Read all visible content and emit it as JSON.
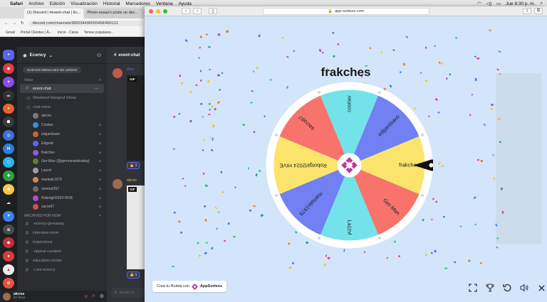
{
  "menubar": {
    "app": "Safari",
    "items": [
      "Archivo",
      "Edición",
      "Visualización",
      "Historial",
      "Marcadores",
      "Ventana",
      "Ayuda"
    ],
    "clock": "Jue 8:30 p. m."
  },
  "back_browser": {
    "tabs": [
      "(1) Discord | #event-chat | Ec...",
      "Photo-essay's posts on dec..."
    ],
    "url": "discord.com/channels/385034496555458/466121",
    "bookmarks": [
      "Gmail",
      "Portal Clientes | A...",
      "Inicio - Caixa",
      "Temas populares..."
    ]
  },
  "discord": {
    "server_name": "Ecency",
    "new_messages": "NUEVOS MENSAJES NO LEÍDOS",
    "voice_category": "Voice",
    "channels_top": [
      {
        "name": "event-chat",
        "active": true
      },
      {
        "name": "Weekend Hangout Show",
        "active": false
      },
      {
        "name": "chat-voice",
        "active": false
      }
    ],
    "voice_users": [
      "akrros",
      "Cositav",
      "edgardsaxo",
      "Edgerik",
      "frakches",
      "Ger-Man (@germanandradeg)",
      "Lazzvl",
      "martiale1979",
      "osomar357",
      "Robotgirl2024 HIVE",
      "sacra97"
    ],
    "archived_category": "ARCHIVED FOR NOW",
    "archived_channels": [
      "-ecency-giveaway",
      "interview-room",
      "inspections",
      "-appeal-curators",
      "education-center",
      "-i-am-ecency"
    ],
    "user": {
      "name": "akrros",
      "status": "En línea"
    },
    "chat_channel": "event-chat",
    "chat_user_1": "Mick",
    "chat_user_2": "akrros",
    "gif_label": "GIF",
    "reaction_1": "1",
    "reaction_2": "1",
    "input_placeholder": "Enviar m"
  },
  "front_browser": {
    "url": "app-sorteos.com"
  },
  "wheel": {
    "title": "frakches",
    "pointer_at": "frakches",
    "segments": [
      {
        "label": "frakches",
        "color": "#fbe46b"
      },
      {
        "label": "Ger-Man",
        "color": "#f7736b"
      },
      {
        "label": "Lazzvl",
        "color": "#74e2e9"
      },
      {
        "label": "martiale1979",
        "color": "#7180f2"
      },
      {
        "label": "Robotgirl2024 HIVE",
        "color": "#fbe46b"
      },
      {
        "label": "sacra97",
        "color": "#f7736b"
      },
      {
        "label": "cositav",
        "color": "#74e2e9"
      },
      {
        "label": "edgardsaxo",
        "color": "#7180f2"
      }
    ]
  },
  "footer": {
    "create_text": "Crea tu Ruleta con",
    "brand": "AppSorteos"
  },
  "controls": [
    "fullscreen-icon",
    "trophy-icon",
    "undo-icon",
    "volume-icon",
    "close-icon"
  ]
}
